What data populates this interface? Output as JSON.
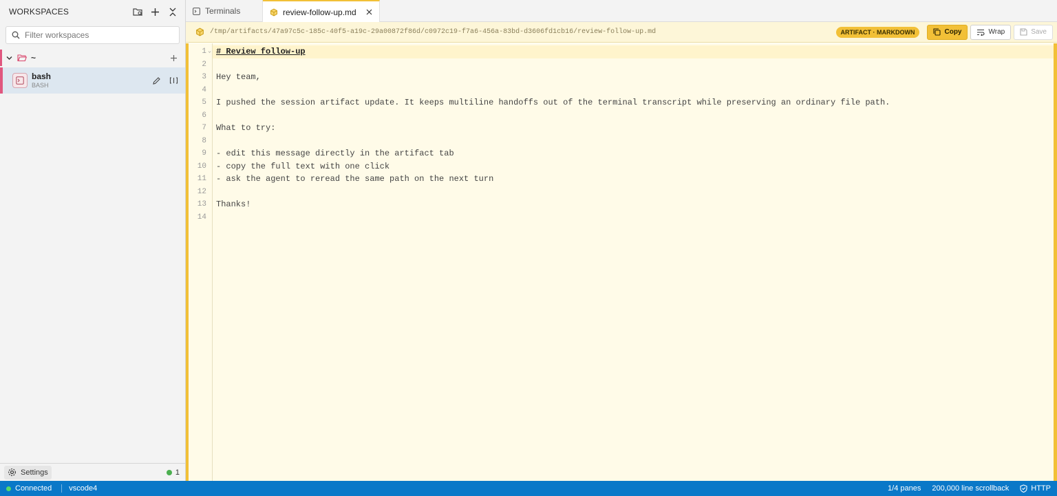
{
  "sidebar": {
    "title": "WORKSPACES",
    "filter_placeholder": "Filter workspaces",
    "group_name": "~",
    "item": {
      "name": "bash",
      "subtitle": "BASH"
    },
    "settings_label": "Settings",
    "connection_count": "1"
  },
  "tabs": [
    {
      "label": "Terminals"
    },
    {
      "label": "review-follow-up.md"
    }
  ],
  "artifact": {
    "path": "/tmp/artifacts/47a97c5c-185c-40f5-a19c-29a00872f86d/c0972c19-f7a6-456a-83bd-d3606fd1cb16/review-follow-up.md",
    "badge": "ARTIFACT · MARKDOWN",
    "copy_label": "Copy",
    "wrap_label": "Wrap",
    "save_label": "Save"
  },
  "editor": {
    "line_numbers": [
      "1",
      "2",
      "3",
      "4",
      "5",
      "6",
      "7",
      "8",
      "9",
      "10",
      "11",
      "12",
      "13",
      "14"
    ],
    "lines": [
      "# Review follow-up",
      "",
      "Hey team,",
      "",
      "I pushed the session artifact update. It keeps multiline handoffs out of the terminal transcript while preserving an ordinary file path.",
      "",
      "What to try:",
      "",
      "- edit this message directly in the artifact tab",
      "- copy the full text with one click",
      "- ask the agent to reread the same path on the next turn",
      "",
      "Thanks!",
      ""
    ]
  },
  "status": {
    "connection": "Connected",
    "host": "vscode4",
    "panes": "1/4 panes",
    "scrollback": "200,000 line scrollback",
    "protocol": "HTTP"
  },
  "colors": {
    "accent": "#f2c037",
    "workspace_marker": "#e0577f",
    "statusbar": "#0a78c8"
  }
}
